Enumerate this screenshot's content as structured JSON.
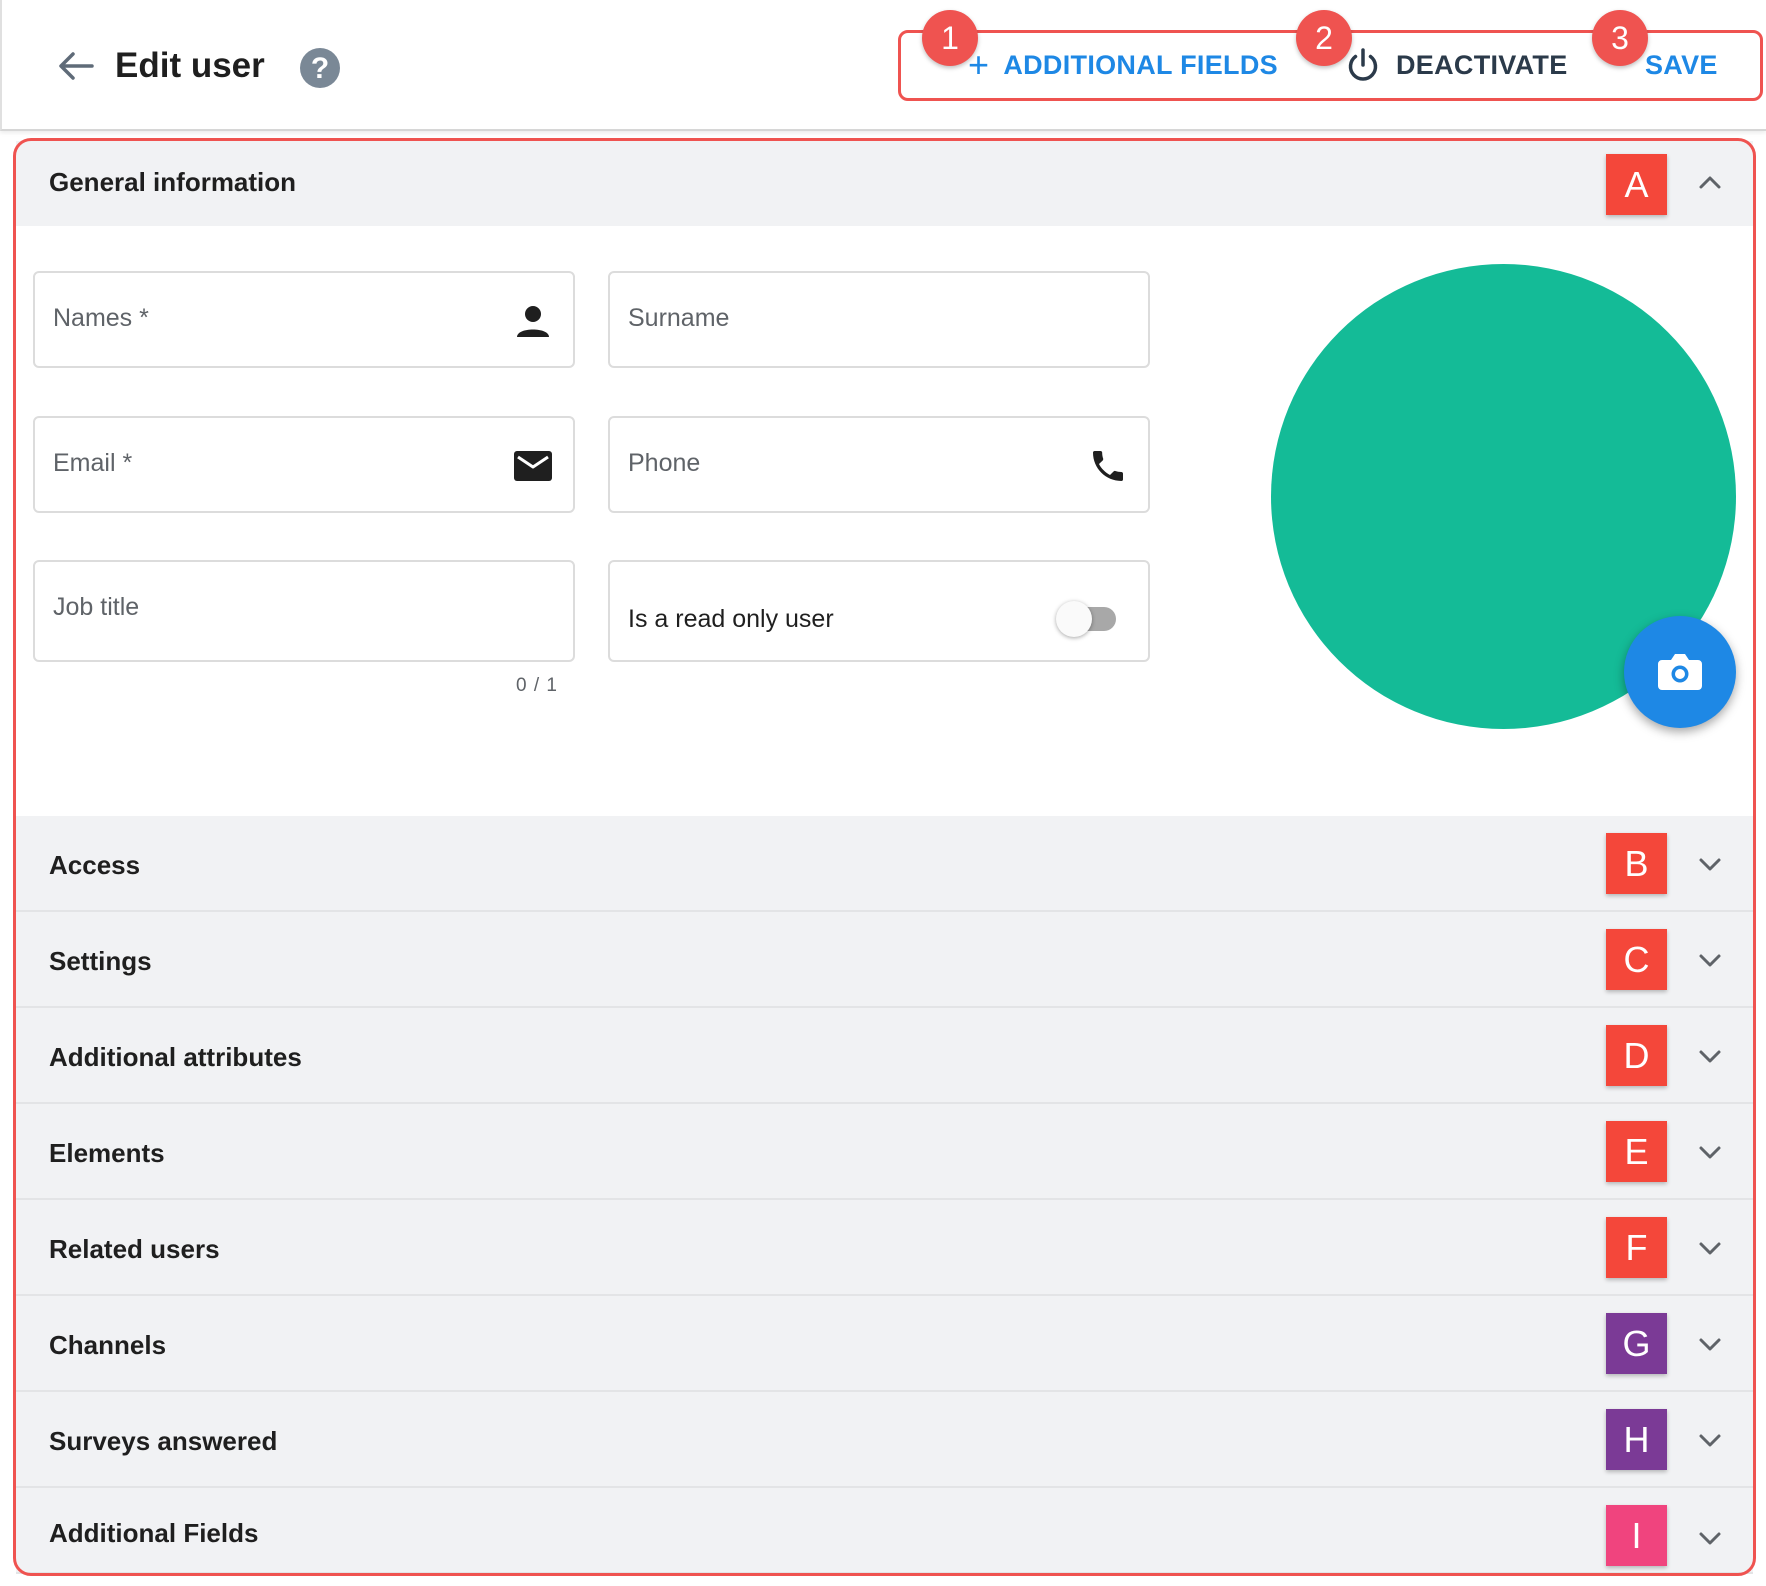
{
  "header": {
    "title": "Edit user",
    "help_symbol": "?",
    "actions": [
      {
        "label": "ADDITIONAL FIELDS",
        "icon": "plus-icon",
        "callout": "1",
        "color": "#1e88e5"
      },
      {
        "label": "DEACTIVATE",
        "icon": "power-icon",
        "callout": "2",
        "color": "#2b3a4a"
      },
      {
        "label": "SAVE",
        "icon": "",
        "callout": "3",
        "color": "#1e88e5"
      }
    ],
    "plus_symbol": "+"
  },
  "general_information": {
    "title": "General information",
    "badge": "A",
    "expanded": true,
    "fields": {
      "names": {
        "label": "Names *",
        "icon": "person-icon",
        "value": ""
      },
      "surname": {
        "label": "Surname",
        "value": ""
      },
      "email": {
        "label": "Email *",
        "icon": "envelope-icon",
        "value": ""
      },
      "phone": {
        "label": "Phone",
        "icon": "phone-icon",
        "value": ""
      },
      "job_title": {
        "label": "Job title",
        "value": "",
        "counter": "0 / 1"
      },
      "read_only": {
        "label": "Is a read only user",
        "checked": false
      }
    },
    "avatar_color": "#14bb97",
    "camera_button_color": "#1e88e5"
  },
  "sections": [
    {
      "title": "Access",
      "badge": "B",
      "badge_color": "#f4473a"
    },
    {
      "title": "Settings",
      "badge": "C",
      "badge_color": "#f4473a"
    },
    {
      "title": "Additional attributes",
      "badge": "D",
      "badge_color": "#f4473a"
    },
    {
      "title": "Elements",
      "badge": "E",
      "badge_color": "#f4473a"
    },
    {
      "title": "Related users",
      "badge": "F",
      "badge_color": "#f4473a"
    },
    {
      "title": "Channels",
      "badge": "G",
      "badge_color": "#7b3a96"
    },
    {
      "title": "Surveys answered",
      "badge": "H",
      "badge_color": "#7b3a96"
    },
    {
      "title": "Additional Fields",
      "badge": "I",
      "badge_color": "#f0447e"
    }
  ],
  "colors": {
    "annotation_red": "#ef5350",
    "accent_blue": "#1e88e5",
    "panel_bg": "#f1f2f4"
  }
}
